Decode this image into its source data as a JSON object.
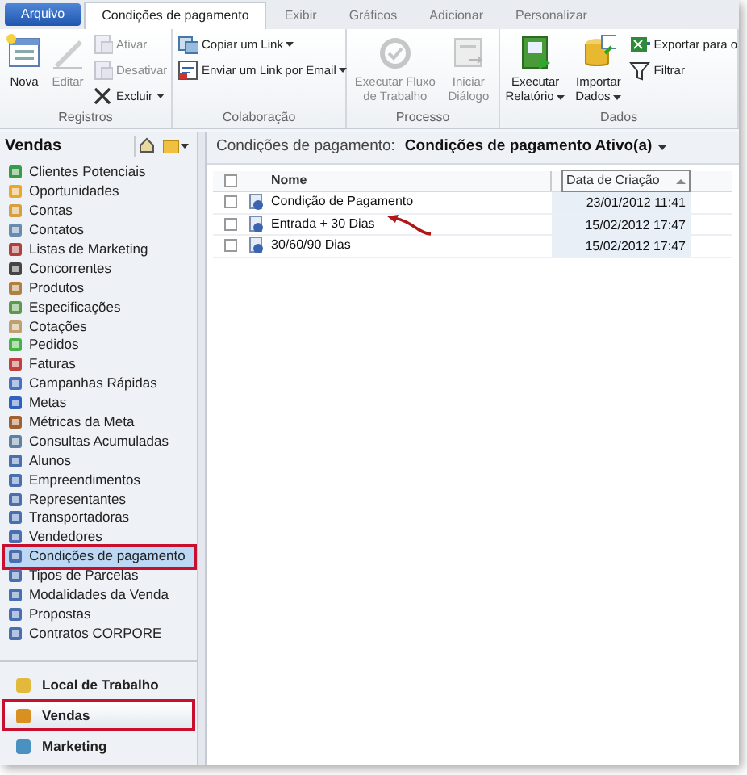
{
  "ribbon_tabs": [
    {
      "label": "Arquivo",
      "kind": "file",
      "selected": false
    },
    {
      "label": "Condições de pagamento",
      "kind": "tab",
      "selected": true
    },
    {
      "label": "Exibir",
      "kind": "tab",
      "selected": false
    },
    {
      "label": "Gráficos",
      "kind": "tab",
      "selected": false
    },
    {
      "label": "Adicionar",
      "kind": "tab",
      "selected": false
    },
    {
      "label": "Personalizar",
      "kind": "tab",
      "selected": false
    }
  ],
  "ribbon_groups": [
    {
      "title": "Registros",
      "buttons": [
        {
          "label": "Nova",
          "kind": "large",
          "disabled": false,
          "dropdown": false
        },
        {
          "label": "Editar",
          "kind": "large",
          "disabled": true,
          "dropdown": false
        },
        {
          "kind": "stack",
          "items": [
            {
              "label": "Ativar",
              "disabled": true,
              "dropdown": false
            },
            {
              "label": "Desativar",
              "disabled": true,
              "dropdown": false
            },
            {
              "label": "Excluir",
              "disabled": false,
              "dropdown": true
            }
          ]
        }
      ]
    },
    {
      "title": "Colaboração",
      "buttons": [
        {
          "kind": "stack",
          "items": [
            {
              "label": "Copiar um Link",
              "disabled": false,
              "dropdown": true
            },
            {
              "label": "Enviar um Link por Email",
              "disabled": false,
              "dropdown": true
            }
          ]
        }
      ]
    },
    {
      "title": "Processo",
      "buttons": [
        {
          "label": "Executar Fluxo de Trabalho",
          "kind": "large",
          "disabled": true,
          "dropdown": false
        },
        {
          "label": "Iniciar Diálogo",
          "kind": "large",
          "disabled": true,
          "dropdown": false
        }
      ]
    },
    {
      "title": "Dados",
      "buttons": [
        {
          "label": "Executar Relatório",
          "kind": "large",
          "disabled": false,
          "dropdown": true
        },
        {
          "label": "Importar Dados",
          "kind": "large",
          "disabled": false,
          "dropdown": true
        },
        {
          "kind": "stack",
          "items": [
            {
              "label": "Exportar para o",
              "disabled": false,
              "dropdown": false
            },
            {
              "label": "Filtrar",
              "disabled": false,
              "dropdown": false
            }
          ]
        }
      ]
    }
  ],
  "sidebar": {
    "title": "Vendas",
    "items": [
      {
        "label": "Clientes Potenciais",
        "selected": false
      },
      {
        "label": "Oportunidades",
        "selected": false
      },
      {
        "label": "Contas",
        "selected": false
      },
      {
        "label": "Contatos",
        "selected": false
      },
      {
        "label": "Listas de Marketing",
        "selected": false
      },
      {
        "label": "Concorrentes",
        "selected": false
      },
      {
        "label": "Produtos",
        "selected": false
      },
      {
        "label": "Especificações",
        "selected": false
      },
      {
        "label": "Cotações",
        "selected": false
      },
      {
        "label": "Pedidos",
        "selected": false
      },
      {
        "label": "Faturas",
        "selected": false
      },
      {
        "label": "Campanhas Rápidas",
        "selected": false
      },
      {
        "label": "Metas",
        "selected": false
      },
      {
        "label": "Métricas da Meta",
        "selected": false
      },
      {
        "label": "Consultas Acumuladas",
        "selected": false
      },
      {
        "label": "Alunos",
        "selected": false
      },
      {
        "label": "Empreendimentos",
        "selected": false
      },
      {
        "label": "Representantes",
        "selected": false
      },
      {
        "label": "Transportadoras",
        "selected": false
      },
      {
        "label": "Vendedores",
        "selected": false
      },
      {
        "label": "Condições de pagamento",
        "selected": true
      },
      {
        "label": "Tipos de Parcelas",
        "selected": false
      },
      {
        "label": "Modalidades da Venda",
        "selected": false
      },
      {
        "label": "Propostas",
        "selected": false
      },
      {
        "label": "Contratos CORPORE",
        "selected": false
      }
    ]
  },
  "nav_areas": [
    {
      "label": "Local de Trabalho",
      "selected": false
    },
    {
      "label": "Vendas",
      "selected": true
    },
    {
      "label": "Marketing",
      "selected": false
    }
  ],
  "view": {
    "entity": "Condições de pagamento:",
    "name": "Condições de pagamento Ativo(a)"
  },
  "table": {
    "all_checked": false,
    "columns": [
      "Nome",
      "Data de Criação"
    ],
    "rows": [
      {
        "cells": [
          "Condição de Pagamento",
          "23/01/2012 11:41"
        ],
        "checked": false,
        "arrow": false
      },
      {
        "cells": [
          "Entrada + 30 Dias",
          "15/02/2012 17:47"
        ],
        "checked": false,
        "arrow": true
      },
      {
        "cells": [
          "30/60/90 Dias",
          "15/02/2012 17:47"
        ],
        "checked": false,
        "arrow": false
      }
    ]
  }
}
